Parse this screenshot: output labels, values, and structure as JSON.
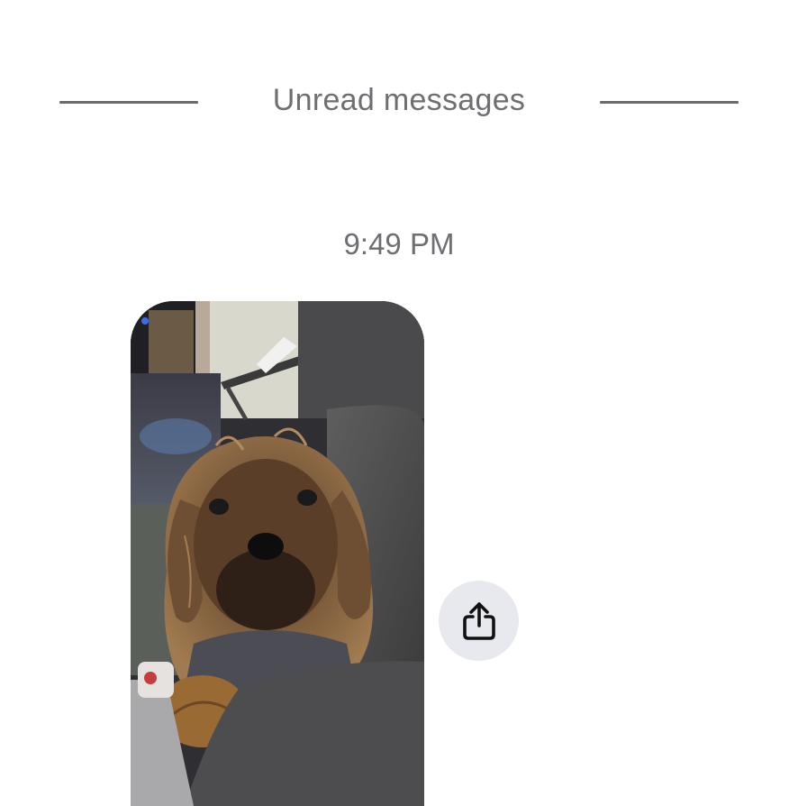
{
  "conversation": {
    "divider": {
      "label": "Unread messages"
    },
    "timestamp": "9:49 PM",
    "messages": [
      {
        "type": "photo",
        "image_icon": "dog-photo",
        "share_icon": "share-icon"
      }
    ]
  },
  "colors": {
    "background": "#ffffff",
    "secondary_text": "#6e6e73",
    "divider": "#6b6b6b",
    "share_button_bg": "#e8e9ee"
  }
}
